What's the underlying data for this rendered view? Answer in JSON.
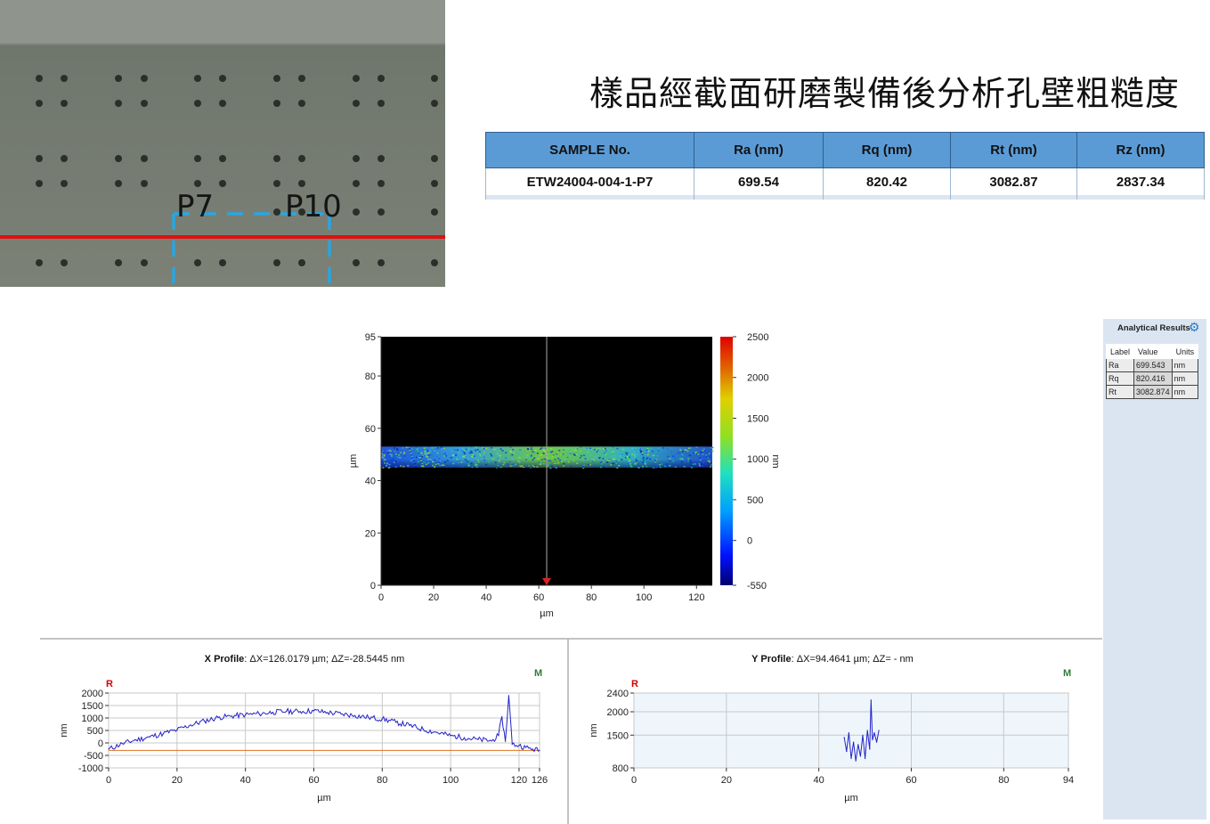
{
  "title": "樣品經截面研磨製備後分析孔壁粗糙度",
  "micrograph": {
    "labels": [
      "P7",
      "P10"
    ]
  },
  "results_table": {
    "headers": [
      "SAMPLE No.",
      "Ra (nm)",
      "Rq (nm)",
      "Rt (nm)",
      "Rz (nm)"
    ],
    "row": [
      "ETW24004-004-1-P7",
      "699.54",
      "820.42",
      "3082.87",
      "2837.34"
    ]
  },
  "analytical_panel": {
    "title": "Analytical Results",
    "headers": [
      "Label",
      "Value",
      "Units"
    ],
    "rows": [
      [
        "Ra",
        "699.543",
        "nm"
      ],
      [
        "Rq",
        "820.416",
        "nm"
      ],
      [
        "Rt",
        "3082.874",
        "nm"
      ]
    ]
  },
  "colors": {
    "header_blue": "#5b9bd5",
    "profile_line": "#2323c8",
    "ref_line": "#e07020",
    "marker_r": "#d00000",
    "marker_m": "#2e7d32",
    "panel_bg": "#dbe5f1"
  },
  "chart_data": [
    {
      "type": "heatmap",
      "xlabel": "µm",
      "ylabel": "µm",
      "xlim": [
        0,
        126
      ],
      "ylim": [
        0,
        95
      ],
      "xticks": [
        "0",
        "20",
        "40",
        "60",
        "80",
        "100",
        "120"
      ],
      "yticks": [
        "0",
        "20",
        "40",
        "60",
        "80",
        "95"
      ],
      "band_y": [
        45,
        53
      ],
      "cursor_x": 63,
      "colorbar": {
        "label": "nm",
        "range": [
          -550,
          2500
        ],
        "ticks": [
          "2500",
          "2000",
          "1500",
          "1000",
          "500",
          "0",
          "-550"
        ]
      }
    },
    {
      "type": "line",
      "title_bold": "X Profile",
      "title_rest": ": ΔX=126.0179 µm; ΔZ=-28.5445 nm",
      "xlabel": "µm",
      "ylabel": "nm",
      "xlim": [
        0,
        126
      ],
      "ylim": [
        -1000,
        2000
      ],
      "xticks": [
        "0",
        "20",
        "40",
        "60",
        "80",
        "100",
        "120",
        "126"
      ],
      "yticks": [
        "2000",
        "1500",
        "1000",
        "500",
        "0",
        "-500",
        "-1000"
      ],
      "markers": [
        "R",
        "M"
      ],
      "reference_y": -300,
      "x": [
        0,
        4,
        8,
        12,
        16,
        20,
        24,
        28,
        32,
        36,
        40,
        44,
        48,
        52,
        56,
        60,
        64,
        68,
        72,
        76,
        80,
        84,
        88,
        92,
        96,
        100,
        104,
        108,
        112,
        114,
        115,
        116,
        117,
        118,
        120,
        122,
        124,
        126
      ],
      "y": [
        -250,
        -30,
        120,
        240,
        380,
        520,
        720,
        880,
        1020,
        1080,
        1130,
        1170,
        1230,
        1270,
        1260,
        1290,
        1220,
        1160,
        1100,
        1020,
        960,
        830,
        700,
        540,
        420,
        290,
        210,
        140,
        80,
        300,
        1050,
        60,
        1900,
        -50,
        -100,
        -180,
        -250,
        -300
      ]
    },
    {
      "type": "line",
      "title_bold": "Y Profile",
      "title_rest": ": ΔX=94.4641 µm; ΔZ= -  nm",
      "xlabel": "µm",
      "ylabel": "nm",
      "xlim": [
        0,
        94
      ],
      "ylim": [
        800,
        2400
      ],
      "xticks": [
        "0",
        "20",
        "40",
        "60",
        "80",
        "94"
      ],
      "yticks": [
        "2400",
        "2000",
        "1500",
        "800"
      ],
      "markers": [
        "R",
        "M"
      ],
      "x": [
        45.5,
        46,
        46.5,
        47,
        47.5,
        48,
        48.5,
        49,
        49.5,
        50,
        50.5,
        51,
        51.3,
        51.6,
        52,
        52.5,
        53
      ],
      "y": [
        1450,
        1150,
        1550,
        1000,
        1350,
        950,
        1300,
        1050,
        1500,
        1000,
        1600,
        1200,
        2250,
        1400,
        1550,
        1350,
        1600
      ]
    }
  ]
}
